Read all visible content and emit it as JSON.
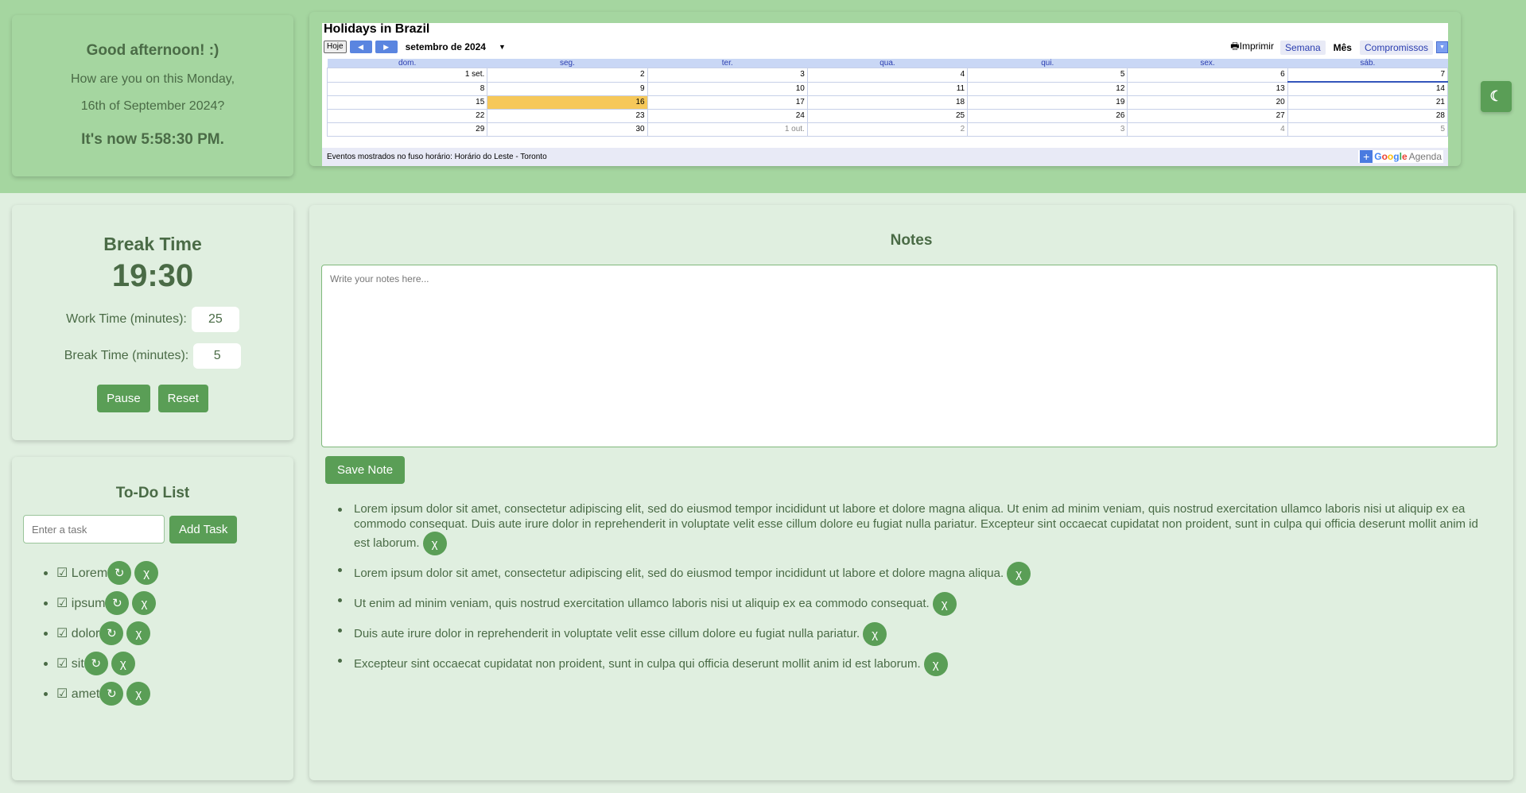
{
  "greeting": {
    "hello": "Good afternoon! :)",
    "line1": "How are you on this Monday,",
    "line2": "16th of September 2024?",
    "now": "It's now 5:58:30 PM."
  },
  "calendar": {
    "title": "Holidays in Brazil",
    "today_label": "Hoje",
    "month": "setembro de 2024",
    "print": "Imprimir",
    "tab_week": "Semana",
    "tab_month": "Mês",
    "tab_agenda": "Compromissos",
    "weekdays": [
      "dom.",
      "seg.",
      "ter.",
      "qua.",
      "qui.",
      "sex.",
      "sáb."
    ],
    "weeks": [
      [
        "1 set.",
        "2",
        "3",
        "4",
        "5",
        "6",
        "7"
      ],
      [
        "8",
        "9",
        "10",
        "11",
        "12",
        "13",
        "14"
      ],
      [
        "15",
        "16",
        "17",
        "18",
        "19",
        "20",
        "21"
      ],
      [
        "22",
        "23",
        "24",
        "25",
        "26",
        "27",
        "28"
      ],
      [
        "29",
        "30",
        "1 out.",
        "2",
        "3",
        "4",
        "5"
      ]
    ],
    "timezone_note": "Eventos mostrados no fuso horário: Horário do Leste - Toronto",
    "badge_google": "Google",
    "badge_agenda": "Agenda"
  },
  "theme_toggle": "☾",
  "pomodoro": {
    "title": "Break Time",
    "time": "19:30",
    "work_label": "Work Time (minutes):",
    "work_value": "25",
    "break_label": "Break Time (minutes):",
    "break_value": "5",
    "pause": "Pause",
    "reset": "Reset"
  },
  "todo": {
    "title": "To-Do List",
    "placeholder": "Enter a task",
    "add": "Add Task",
    "items": [
      "☑ Lorem",
      "☑ ipsum",
      "☑ dolor",
      "☑ sit",
      "☑ amet"
    ],
    "undo_glyph": "↻",
    "delete_glyph": "χ"
  },
  "notes": {
    "title": "Notes",
    "placeholder": "Write your notes here...",
    "save": "Save Note",
    "delete_glyph": "χ",
    "items": [
      "Lorem ipsum dolor sit amet, consectetur adipiscing elit, sed do eiusmod tempor incididunt ut labore et dolore magna aliqua. Ut enim ad minim veniam, quis nostrud exercitation ullamco laboris nisi ut aliquip ex ea commodo consequat. Duis aute irure dolor in reprehenderit in voluptate velit esse cillum dolore eu fugiat nulla pariatur. Excepteur sint occaecat cupidatat non proident, sunt in culpa qui officia deserunt mollit anim id est laborum.",
      "Lorem ipsum dolor sit amet, consectetur adipiscing elit, sed do eiusmod tempor incididunt ut labore et dolore magna aliqua.",
      "Ut enim ad minim veniam, quis nostrud exercitation ullamco laboris nisi ut aliquip ex ea commodo consequat.",
      "Duis aute irure dolor in reprehenderit in voluptate velit esse cillum dolore eu fugiat nulla pariatur.",
      "Excepteur sint occaecat cupidatat non proident, sunt in culpa qui officia deserunt mollit anim id est laborum."
    ]
  },
  "colors": {
    "background": "#a5d6a0",
    "panel_light": "#e0efe0",
    "accent": "#5a9e56",
    "text": "#4a6b46",
    "calendar_today": "#f6c85a"
  }
}
